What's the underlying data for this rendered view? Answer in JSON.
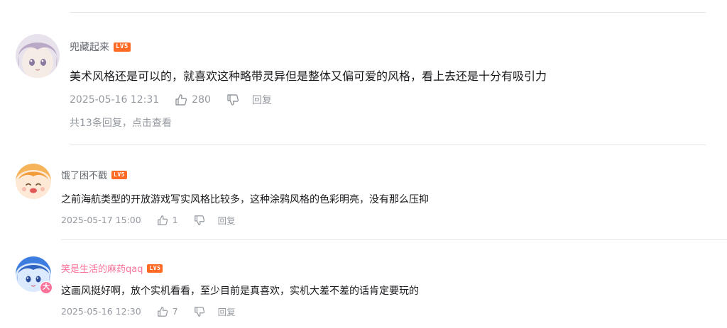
{
  "comments": [
    {
      "username": "兜藏起来",
      "level": "LV5",
      "content": "美术风格还是可以的，就喜欢这种略带灵异但是整体又偏可爱的风格，看上去还是十分有吸引力",
      "time": "2025-05-16 12:31",
      "likes": "280",
      "reply_label": "回复",
      "replies_summary": "共13条回复，点击查看"
    },
    {
      "username": "饿了困不戳",
      "level": "LV5",
      "content": "之前海航类型的开放游戏写实风格比较多，这种涂鸦风格的色彩明亮，没有那么压抑",
      "time": "2025-05-17 15:00",
      "likes": "1",
      "reply_label": "回复"
    },
    {
      "username": "笑是生活的麻药qaq",
      "level": "LV5",
      "avatar_badge": "大",
      "content": "这画风挺好啊，放个实机看看，至少目前是真喜欢，实机大差不差的话肯定要玩的",
      "time": "2025-05-16 12:30",
      "likes": "7",
      "reply_label": "回复"
    }
  ],
  "colors": {
    "vip_username": "#fb7299",
    "level_badge": "#ff6b25",
    "meta_text": "#9499a0",
    "divider": "#e3e5e7"
  },
  "icons": [
    "thumb-up-icon",
    "thumb-down-icon"
  ]
}
